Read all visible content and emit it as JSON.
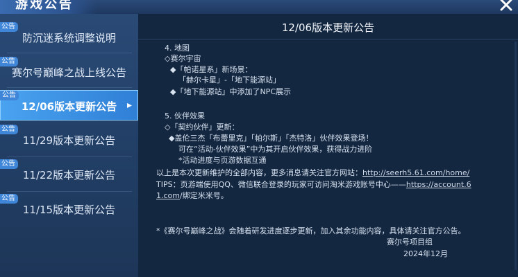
{
  "header": {
    "title": "游戏公告",
    "close_icon": "close-icon"
  },
  "sidebar": {
    "items": [
      {
        "tag": "公告",
        "label": "防沉迷系统调整说明"
      },
      {
        "tag": "公告",
        "label": "赛尔号巅峰之战上线公告"
      },
      {
        "tag": "公告",
        "label": "12/06版本更新公告",
        "active": true
      },
      {
        "tag": "公告",
        "label": "11/29版本更新公告"
      },
      {
        "tag": "公告",
        "label": "11/22版本更新公告"
      },
      {
        "tag": "公告",
        "label": "11/15版本更新公告"
      }
    ]
  },
  "content": {
    "title": "12/06版本更新公告",
    "map_section": {
      "heading": "4. 地图",
      "sub": "◇赛尔宇宙",
      "b1": "◆「帕诺星系」新场景：",
      "b1_detail": "「赫尔卡星」-「地下能源站」",
      "b2": "◆「地下能源站」中添加了NPC展示"
    },
    "partner_section": {
      "heading": "5. 伙伴效果",
      "sub": "◇「契约伙伴」更新：",
      "b1": "◆盖伦三杰「布蕾里克」「帕尔斯」「杰特洛」伙伴效果登场！",
      "b1_detail": "可在“活动-伙伴效果”中为其开启伙伴效果，获得战力进阶",
      "note": "*活动进度与页游数据互通"
    },
    "footer_info": {
      "line1_text": "以上是本次更新维护的全部内容，更多消息请关注官方网站：",
      "line1_link": "http://seerh5.61.com/home/",
      "tips_text": "TIPS：页游端使用QQ、微信联合登录的玩家可访问淘米游戏账号中心——",
      "tips_link": "https://account.6",
      "tips_link_cont": "1.com",
      "tips_end": "/绑定米米号。"
    },
    "closing": {
      "note": "*《赛尔号巅峰之战》会随着研发进度逐步更新，加入其余功能内容，具体请关注官方公告。",
      "org": "赛尔号项目组",
      "date": "2024年12月"
    }
  },
  "colors": {
    "accent": "#3f86d8",
    "active_item": "#4aa3f0",
    "panel_bg": "#142740"
  }
}
